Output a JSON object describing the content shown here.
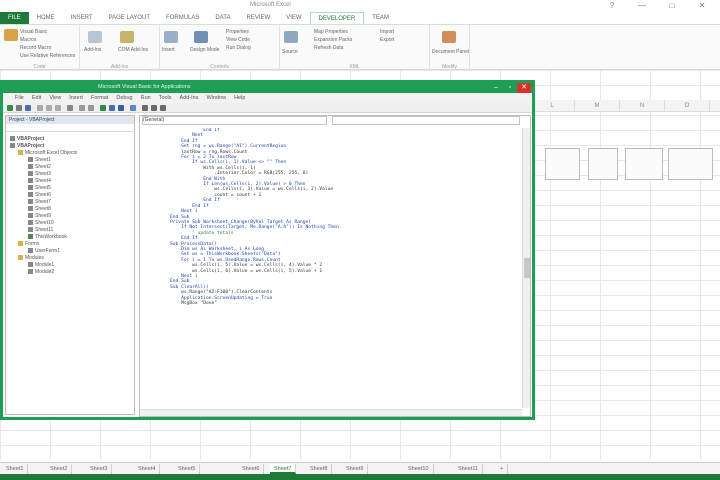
{
  "excel": {
    "title": "Microsoft Excel",
    "window_controls": [
      "?",
      "—",
      "□",
      "✕"
    ],
    "tabs": [
      "FILE",
      "HOME",
      "INSERT",
      "PAGE LAYOUT",
      "FORMULAS",
      "DATA",
      "REVIEW",
      "VIEW",
      "DEVELOPER",
      "TEAM"
    ],
    "active_tab": "DEVELOPER"
  },
  "ribbon": {
    "groups": [
      {
        "label": "Code",
        "buttons": [
          "Visual Basic",
          "Macros",
          "Record Macro",
          "Use Relative References",
          "Macro Security"
        ]
      },
      {
        "label": "Add-Ins",
        "buttons": [
          "Add-Ins",
          "COM Add-Ins"
        ]
      },
      {
        "label": "Controls",
        "buttons": [
          "Insert",
          "Design Mode",
          "Properties",
          "View Code",
          "Run Dialog"
        ]
      },
      {
        "label": "XML",
        "buttons": [
          "Source",
          "Map Properties",
          "Expansion Packs",
          "Refresh Data",
          "Import",
          "Export"
        ]
      },
      {
        "label": "Modify",
        "buttons": [
          "Document Panel"
        ]
      }
    ]
  },
  "sheet": {
    "columns": [
      "L",
      "M",
      "N",
      "O"
    ],
    "headers": [
      "",
      "",
      "",
      ""
    ],
    "row1": [
      "",
      "",
      "",
      ""
    ],
    "row2": [
      "",
      "",
      "",
      ""
    ]
  },
  "vbe": {
    "title": "Microsoft Visual Basic for Applications",
    "menu": [
      "File",
      "Edit",
      "View",
      "Insert",
      "Format",
      "Debug",
      "Run",
      "Tools",
      "Add-Ins",
      "Window",
      "Help"
    ],
    "project_title": "Project - VBAProject",
    "tree": [
      "VBAProject",
      "VBAProject",
      "Microsoft Excel Objects",
      "Sheet1",
      "Sheet2",
      "Sheet3",
      "Sheet4",
      "Sheet5",
      "Sheet6",
      "Sheet7",
      "Sheet8",
      "Sheet9",
      "Sheet10",
      "Sheet11",
      "ThisWorkbook",
      "Forms",
      "UserForm1",
      "Modules",
      "Module1",
      "Module2"
    ],
    "object_dropdown": "(General)",
    "proc_dropdown": "",
    "code_lines": [
      "            End If",
      "        Next",
      "    End If",
      "",
      "    Set rng = ws.Range(\"A1\").CurrentRegion",
      "    lastRow = rng.Rows.Count",
      "    For i = 2 To lastRow",
      "        If ws.Cells(i, 1).Value <> \"\" Then",
      "            With ws.Cells(i, 1)",
      "                .Interior.Color = RGB(255, 255, 0)",
      "            End With",
      "            If Len(ws.Cells(i, 2).Value) > 0 Then",
      "                ws.Cells(i, 3).Value = ws.Cells(i, 2).Value",
      "                count = count + 1",
      "            End If",
      "        End If",
      "    Next i",
      "End Sub",
      "",
      "Private Sub Worksheet_Change(ByVal Target As Range)",
      "    If Not Intersect(Target, Me.Range(\"A:A\")) Is Nothing Then",
      "        ' update totals",
      "    End If",
      "",
      "Sub ProcessData()",
      "    Dim ws As Worksheet, i As Long",
      "    Set ws = ThisWorkbook.Sheets(\"Data\")",
      "    For i = 1 To ws.UsedRange.Rows.Count",
      "        ws.Cells(i, 5).Value = ws.Cells(i, 4).Value * 2",
      "        ws.Cells(i, 6).Value = ws.Cells(i, 5).Value + 1",
      "    Next i",
      "End Sub",
      "",
      "Sub ClearAll()",
      "    ws.Range(\"A2:F100\").ClearContents",
      "",
      "    Application.ScreenUpdating = True",
      "    MsgBox \"Done\""
    ]
  },
  "sheet_tabs": [
    "Sheet1",
    "Sheet2",
    "Sheet3",
    "Sheet4",
    "Sheet5",
    "Sheet6",
    "Sheet7",
    "Sheet8",
    "Sheet9",
    "Sheet10",
    "Sheet11",
    "+"
  ],
  "active_sheet_index": 6,
  "colors": {
    "excel_green": "#1f7a3a",
    "vbe_frame": "#1e9e55",
    "keyword": "#1f3fb0",
    "comment": "#2e8b3c"
  }
}
